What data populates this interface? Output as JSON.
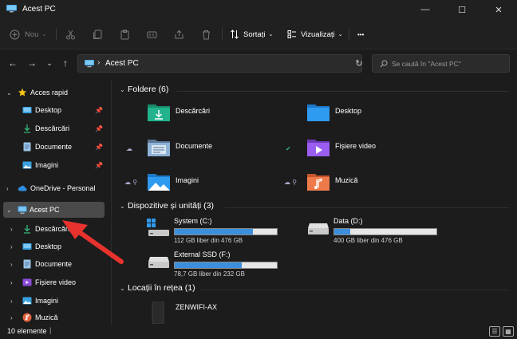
{
  "window": {
    "title": "Acest PC",
    "minimize": "—",
    "maximize": "☐",
    "close": "✕"
  },
  "toolbar": {
    "new_label": "Nou",
    "sort_label": "Sortați",
    "view_label": "Vizualizați",
    "more_label": "•••"
  },
  "address": {
    "crumb": "Acest PC",
    "search_placeholder": "Se caută în \"Acest PC\""
  },
  "sidebar": {
    "items": [
      {
        "label": "Acces rapid",
        "icon": "star-icon"
      },
      {
        "label": "Desktop",
        "icon": "desktop-icon",
        "pinned": true
      },
      {
        "label": "Descărcări",
        "icon": "download-icon",
        "pinned": true
      },
      {
        "label": "Documente",
        "icon": "document-icon",
        "pinned": true
      },
      {
        "label": "Imagini",
        "icon": "image-icon",
        "pinned": true
      },
      {
        "label": "OneDrive - Personal",
        "icon": "cloud-icon"
      },
      {
        "label": "Acest PC",
        "icon": "pc-icon",
        "selected": true
      },
      {
        "label": "Descărcări",
        "icon": "download-icon"
      },
      {
        "label": "Desktop",
        "icon": "desktop-icon"
      },
      {
        "label": "Documente",
        "icon": "document-icon"
      },
      {
        "label": "Fișiere video",
        "icon": "video-icon"
      },
      {
        "label": "Imagini",
        "icon": "image-icon"
      },
      {
        "label": "Muzică",
        "icon": "music-icon"
      }
    ]
  },
  "content": {
    "folders_header": "Foldere (6)",
    "folders": [
      {
        "name": "Descărcări",
        "icon": "download-folder-icon"
      },
      {
        "name": "Desktop",
        "icon": "desktop-folder-icon"
      },
      {
        "name": "Documente",
        "icon": "documents-folder-icon"
      },
      {
        "name": "Fișiere video",
        "icon": "videos-folder-icon"
      },
      {
        "name": "Imagini",
        "icon": "pictures-folder-icon"
      },
      {
        "name": "Muzică",
        "icon": "music-folder-icon"
      }
    ],
    "drives_header": "Dispozitive și unități (3)",
    "drives": [
      {
        "name": "System (C:)",
        "free": "112 GB liber din 476 GB",
        "used_fraction": 0.765
      },
      {
        "name": "Data (D:)",
        "free": "400 GB liber din 476 GB",
        "used_fraction": 0.16
      },
      {
        "name": "External SSD (F:)",
        "free": "78,7 GB liber din 232 GB",
        "used_fraction": 0.66
      }
    ],
    "network_header": "Locații în rețea (1)",
    "network": [
      {
        "name": "ZENWIFI-AX"
      }
    ]
  },
  "status": {
    "count": "10 elemente",
    "cursor": "|"
  },
  "colors": {
    "accent": "#3c8fdc",
    "annotation_arrow": "#e8322e"
  }
}
